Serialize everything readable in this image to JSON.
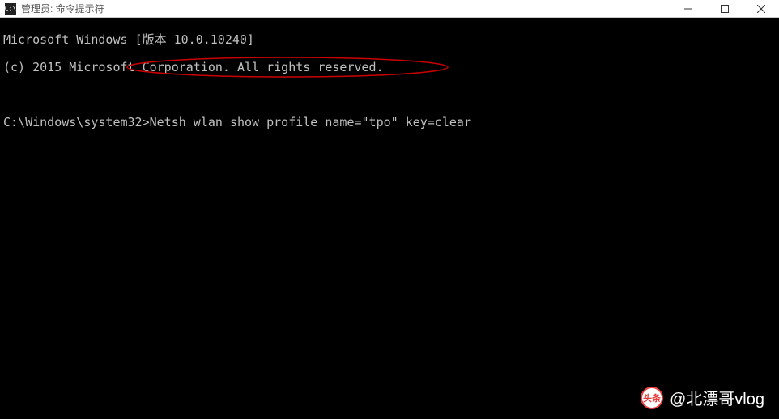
{
  "titlebar": {
    "icon_label": "C:\\",
    "title": "管理员: 命令提示符"
  },
  "terminal": {
    "line1": "Microsoft Windows [版本 10.0.10240]",
    "line2": "(c) 2015 Microsoft Corporation. All rights reserved.",
    "prompt": "C:\\Windows\\system32>",
    "command": "Netsh wlan show profile name=\"tpo\" key=clear"
  },
  "watermark": {
    "logo_text": "头条",
    "text": "@北漂哥vlog"
  }
}
